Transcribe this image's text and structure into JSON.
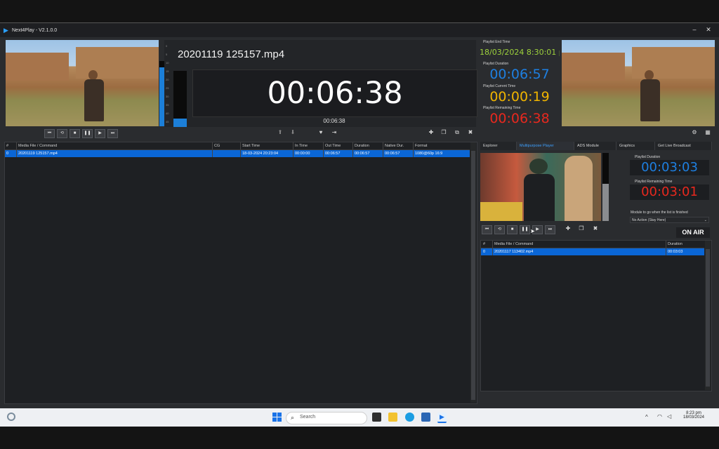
{
  "app": {
    "title": "Next4Play - V2.1.0.0",
    "logo_icon": "play-logo-icon"
  },
  "left_player": {
    "filename": "20201119 125157.mp4",
    "time": "00:06:38",
    "time_small": "00:06:38",
    "vu_scale": [
      "0",
      "5",
      "10",
      "15",
      "20",
      "25",
      "30",
      "35",
      "40",
      "45"
    ],
    "vu_level": 0.15,
    "preview_vu_level": 0.9
  },
  "playlist_info": {
    "end_time_label": "Playlist End Time",
    "end_time": "18/03/2024 8:30:01 pm",
    "duration_label": "Playlist Duration",
    "duration": "00:06:57",
    "current_label": "Playlist Current Time",
    "current": "00:00:19",
    "remaining_label": "Playlist Remaining Time",
    "remaining": "00:06:38",
    "colors": {
      "end": "#9ed23c",
      "duration": "#1e7fe0",
      "current": "#f0b400",
      "remaining": "#e8281e"
    }
  },
  "main_table": {
    "headers": [
      "#",
      "Media File / Command",
      "CG",
      "Start Time",
      "In Time",
      "Out Time",
      "Duration",
      "Native Dur.",
      "Format"
    ],
    "rows": [
      [
        "0",
        "20201119 125157.mp4",
        "",
        "18-03-2024 20:23:04",
        "00:00:00",
        "00:06:57",
        "00:06:57",
        "00:06:57",
        "1080@60p 16:9"
      ]
    ]
  },
  "tabs": [
    "Explorer",
    "Multipurpose Player",
    "ADS Module",
    "Graphics",
    "Get Live Broadcast"
  ],
  "active_tab": 1,
  "mp": {
    "duration_label": "Playlist Duration",
    "duration": "00:03:03",
    "remaining_label": "Playlist Remaining Time",
    "remaining": "00:03:01",
    "module_label": "Module to go when the list is finished",
    "module_value": "No Action (Stay Here)",
    "on_air": "ON AIR",
    "vu_scale": [
      "0",
      "5",
      "10",
      "15",
      "20",
      "25",
      "30",
      "35",
      "40"
    ],
    "vu_level": 0.55,
    "table": {
      "headers": [
        "#",
        "Media File / Command",
        "Duration"
      ],
      "rows": [
        [
          "0",
          "20201117 113402.mp4",
          "00:03:03"
        ]
      ]
    }
  },
  "taskbar": {
    "search_placeholder": "Search",
    "time": "8:23 pm",
    "date": "18/03/2024"
  }
}
